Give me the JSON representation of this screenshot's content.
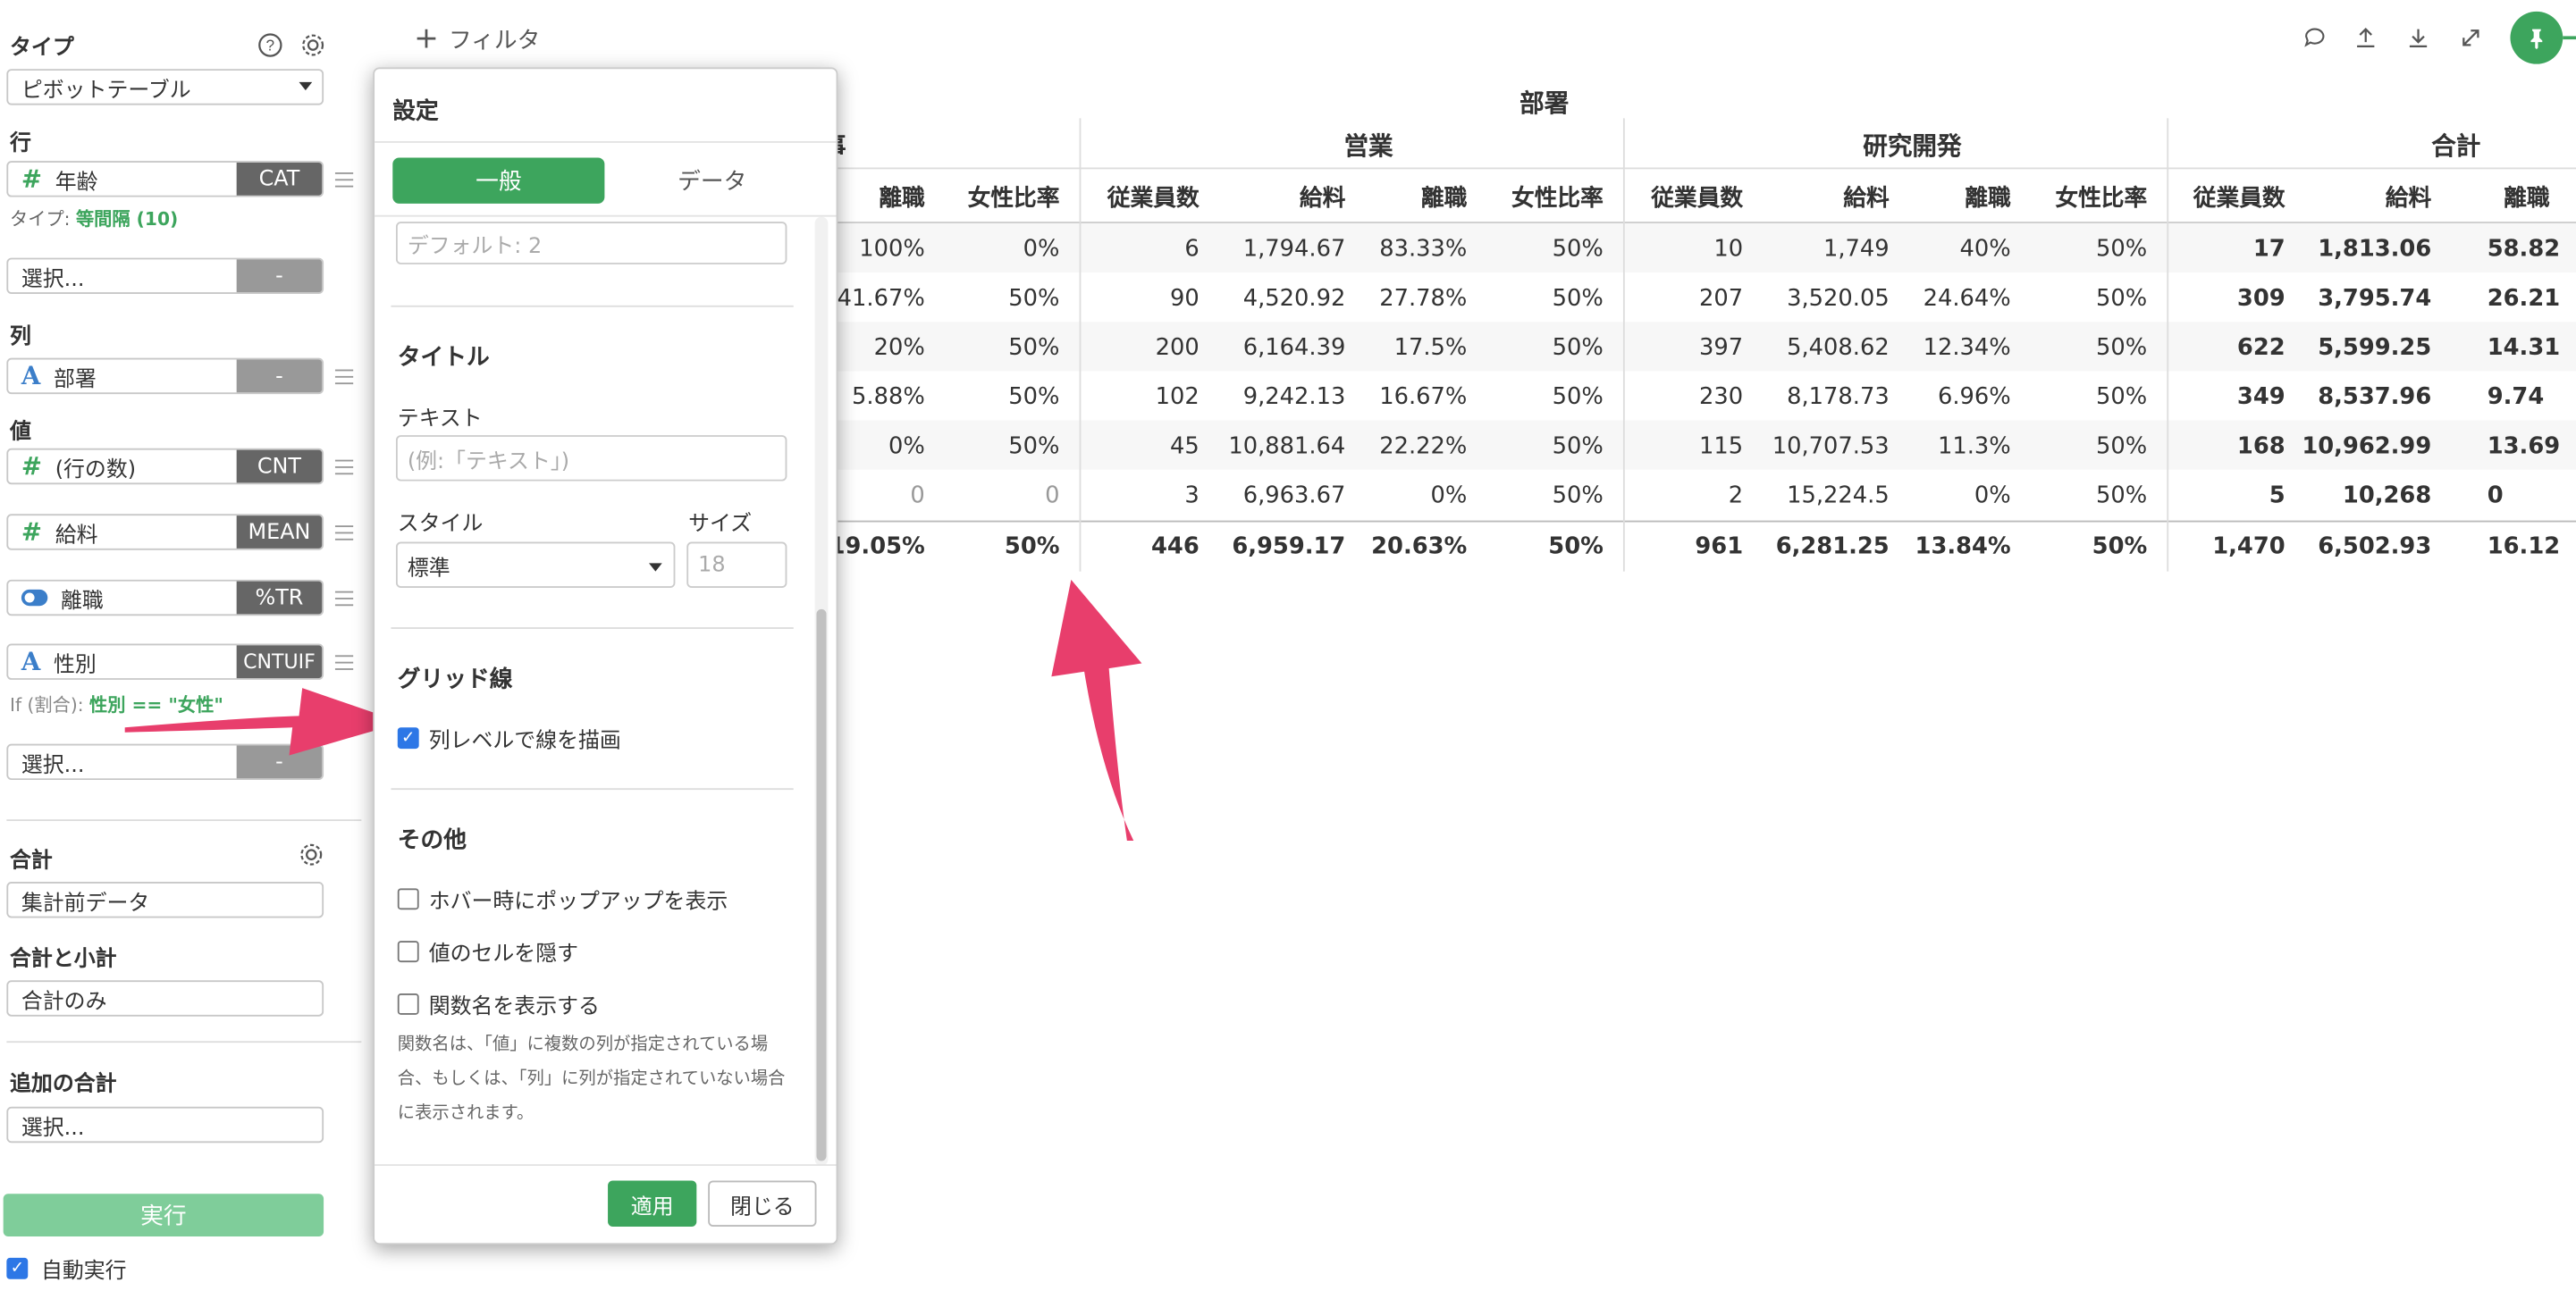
{
  "left_panel": {
    "type_label": "タイプ",
    "type_value": "ピボットテーブル",
    "rows_label": "行",
    "rows_field": {
      "name": "年齢",
      "agg": "CAT"
    },
    "rows_type_prefix": "タイプ:",
    "rows_type_value": "等間隔 (10)",
    "select_placeholder": "選択...",
    "dash": "-",
    "cols_label": "列",
    "cols_field": {
      "name": "部署",
      "agg": "-"
    },
    "values_label": "値",
    "value_fields": [
      {
        "name": "(行の数)",
        "agg": "CNT"
      },
      {
        "name": "給料",
        "agg": "MEAN"
      },
      {
        "name": "離職",
        "agg": "%TR"
      },
      {
        "name": "性別",
        "agg": "CNTUIF"
      }
    ],
    "if_prefix": "If (割合):",
    "if_condition": "性別 == \"女性\"",
    "total_label": "合計",
    "total_value": "集計前データ",
    "subtotal_label": "合計と小計",
    "subtotal_value": "合計のみ",
    "additional_total_label": "追加の合計",
    "additional_total_value": "選択...",
    "run_button": "実行",
    "auto_run_label": "自動実行"
  },
  "toolbar": {
    "filter_label": "フィルタ"
  },
  "dialog": {
    "title": "設定",
    "tabs": [
      "一般",
      "データ"
    ],
    "default_placeholder": "デフォルト: 2",
    "title_section": "タイトル",
    "text_label": "テキスト",
    "text_placeholder": "(例:「テキスト」)",
    "style_label": "スタイル",
    "style_value": "標準",
    "size_label": "サイズ",
    "size_placeholder": "18",
    "grid_section": "グリッド線",
    "grid_checkbox": "列レベルで線を描画",
    "other_section": "その他",
    "other_checkboxes": [
      "ホバー時にポップアップを表示",
      "値のセルを隠す",
      "関数名を表示する"
    ],
    "note": "関数名は、「値」に複数の列が指定されている場合、もしくは、「列」に列が指定されていない場合に表示されます。",
    "apply_button": "適用",
    "close_button": "閉じる"
  },
  "table": {
    "column_group_title": "部署",
    "groups": [
      "事",
      "営業",
      "研究開発",
      "合計"
    ],
    "sub_headers": [
      "従業員数",
      "給料",
      "離職",
      "女性比率"
    ],
    "partial_group_cols": [
      [
        "100%",
        "0%"
      ],
      [
        "41.67%",
        "50%"
      ],
      [
        "20%",
        "50%"
      ],
      [
        "5.88%",
        "50%"
      ],
      [
        "0%",
        "50%"
      ],
      [
        "0",
        "0"
      ]
    ],
    "partial_total": [
      "19.05%",
      "50%"
    ],
    "sales_rows": [
      [
        "6",
        "1,794.67",
        "83.33%",
        "50%"
      ],
      [
        "90",
        "4,520.92",
        "27.78%",
        "50%"
      ],
      [
        "200",
        "6,164.39",
        "17.5%",
        "50%"
      ],
      [
        "102",
        "9,242.13",
        "16.67%",
        "50%"
      ],
      [
        "45",
        "10,881.64",
        "22.22%",
        "50%"
      ],
      [
        "3",
        "6,963.67",
        "0%",
        "50%"
      ]
    ],
    "sales_total": [
      "446",
      "6,959.17",
      "20.63%",
      "50%"
    ],
    "rd_rows": [
      [
        "10",
        "1,749",
        "40%",
        "50%"
      ],
      [
        "207",
        "3,520.05",
        "24.64%",
        "50%"
      ],
      [
        "397",
        "5,408.62",
        "12.34%",
        "50%"
      ],
      [
        "230",
        "8,178.73",
        "6.96%",
        "50%"
      ],
      [
        "115",
        "10,707.53",
        "11.3%",
        "50%"
      ],
      [
        "2",
        "15,224.5",
        "0%",
        "50%"
      ]
    ],
    "rd_total": [
      "961",
      "6,281.25",
      "13.84%",
      "50%"
    ],
    "total_sub_headers": [
      "従業員数",
      "給料",
      "離職"
    ],
    "total_rows": [
      [
        "17",
        "1,813.06",
        "58.82"
      ],
      [
        "309",
        "3,795.74",
        "26.21"
      ],
      [
        "622",
        "5,599.25",
        "14.31"
      ],
      [
        "349",
        "8,537.96",
        "9.74"
      ],
      [
        "168",
        "10,962.99",
        "13.69"
      ],
      [
        "5",
        "10,268",
        "0"
      ]
    ],
    "total_total": [
      "1,470",
      "6,502.93",
      "16.12"
    ]
  },
  "colors": {
    "accent_green": "#3da55d",
    "arrow_pink": "#e83e6c",
    "checkbox_blue": "#2d77e6"
  },
  "icons": [
    "help-icon",
    "gear-icon",
    "plus-icon",
    "comment-icon",
    "upload-icon",
    "download-icon",
    "expand-icon",
    "pin-icon"
  ]
}
